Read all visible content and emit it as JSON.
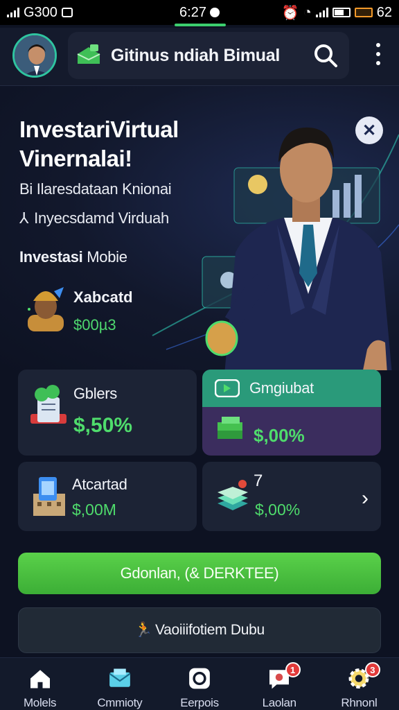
{
  "status_bar": {
    "carrier": "G300",
    "time": "6:27",
    "battery": "62"
  },
  "header": {
    "title": "Gitinus ndiah Bimual"
  },
  "hero": {
    "title": "InvestariVirtual Vinernalai!",
    "subtitle": "Bi Ilaresdataan Knionai",
    "subtitle2": "Inyecsdamd Virduah",
    "section_label_bold": "Investasi",
    "section_label_rest": " Mobie",
    "mini_name": "Xabcatd",
    "mini_value": "$00µ3"
  },
  "cards": [
    {
      "title": "Gblers",
      "value": "$,50%"
    },
    {
      "title": "Gmgiubat",
      "value": "$,00%"
    },
    {
      "title": "Atcartad",
      "value": "$,00M"
    },
    {
      "title": "7",
      "value": "$,00%"
    }
  ],
  "buttons": {
    "primary": "Gdonlan, (& DERKTEE)",
    "secondary": "Vaoiiifotiem Dubu"
  },
  "nav": [
    {
      "label": "Molels",
      "icon": "home-icon"
    },
    {
      "label": "Cmmioty",
      "icon": "envelope-icon"
    },
    {
      "label": "Eerpois",
      "icon": "circle-icon"
    },
    {
      "label": "Laolan",
      "icon": "chat-icon",
      "badge": "1"
    },
    {
      "label": "Rhnonl",
      "icon": "gear-icon",
      "badge": "3"
    }
  ],
  "colors": {
    "accent_green": "#4fdc6c",
    "teal": "#2a9a7a",
    "background": "#0d1222"
  }
}
